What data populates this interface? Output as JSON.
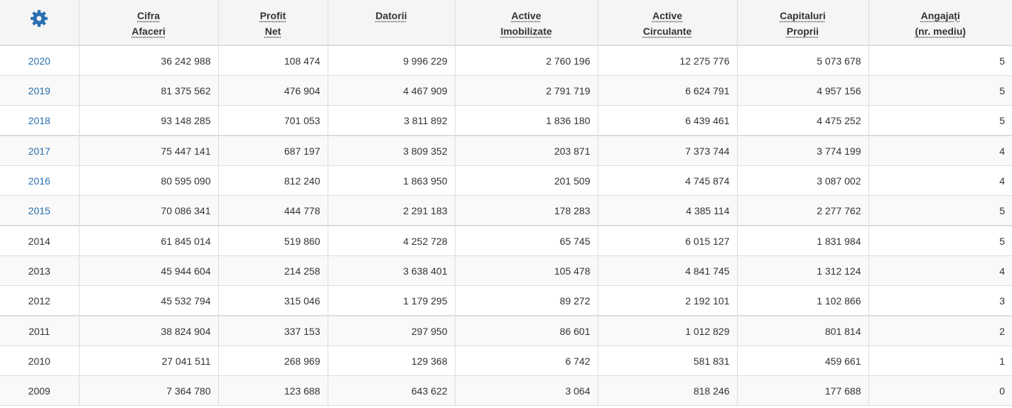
{
  "table": {
    "settings_icon": "gear-icon",
    "accent_color": "#2a6fb0",
    "columns": [
      {
        "key": "cifra_afaceri",
        "line1": "Cifra",
        "line2": "Afaceri"
      },
      {
        "key": "profit_net",
        "line1": "Profit",
        "line2": "Net"
      },
      {
        "key": "datorii",
        "line1": "Datorii",
        "line2": ""
      },
      {
        "key": "active_imobilizate",
        "line1": "Active",
        "line2": "Imobilizate"
      },
      {
        "key": "active_circulante",
        "line1": "Active",
        "line2": "Circulante"
      },
      {
        "key": "capitaluri_proprii",
        "line1": "Capitaluri",
        "line2": "Proprii"
      },
      {
        "key": "angajati",
        "line1": "Angajați",
        "line2": "(nr. mediu)"
      }
    ],
    "rows": [
      {
        "year": "2020",
        "linked": true,
        "values": [
          "36 242 988",
          "108 474",
          "9 996 229",
          "2 760 196",
          "12 275 776",
          "5 073 678",
          "5"
        ]
      },
      {
        "year": "2019",
        "linked": true,
        "values": [
          "81 375 562",
          "476 904",
          "4 467 909",
          "2 791 719",
          "6 624 791",
          "4 957 156",
          "5"
        ]
      },
      {
        "year": "2018",
        "linked": true,
        "values": [
          "93 148 285",
          "701 053",
          "3 811 892",
          "1 836 180",
          "6 439 461",
          "4 475 252",
          "5"
        ]
      },
      {
        "year": "2017",
        "linked": true,
        "values": [
          "75 447 141",
          "687 197",
          "3 809 352",
          "203 871",
          "7 373 744",
          "3 774 199",
          "4"
        ]
      },
      {
        "year": "2016",
        "linked": true,
        "values": [
          "80 595 090",
          "812 240",
          "1 863 950",
          "201 509",
          "4 745 874",
          "3 087 002",
          "4"
        ]
      },
      {
        "year": "2015",
        "linked": true,
        "values": [
          "70 086 341",
          "444 778",
          "2 291 183",
          "178 283",
          "4 385 114",
          "2 277 762",
          "5"
        ]
      },
      {
        "year": "2014",
        "linked": false,
        "values": [
          "61 845 014",
          "519 860",
          "4 252 728",
          "65 745",
          "6 015 127",
          "1 831 984",
          "5"
        ]
      },
      {
        "year": "2013",
        "linked": false,
        "values": [
          "45 944 604",
          "214 258",
          "3 638 401",
          "105 478",
          "4 841 745",
          "1 312 124",
          "4"
        ]
      },
      {
        "year": "2012",
        "linked": false,
        "values": [
          "45 532 794",
          "315 046",
          "1 179 295",
          "89 272",
          "2 192 101",
          "1 102 866",
          "3"
        ]
      },
      {
        "year": "2011",
        "linked": false,
        "values": [
          "38 824 904",
          "337 153",
          "297 950",
          "86 601",
          "1 012 829",
          "801 814",
          "2"
        ]
      },
      {
        "year": "2010",
        "linked": false,
        "values": [
          "27 041 511",
          "268 969",
          "129 368",
          "6 742",
          "581 831",
          "459 661",
          "1"
        ]
      },
      {
        "year": "2009",
        "linked": false,
        "values": [
          "7 364 780",
          "123 688",
          "643 622",
          "3 064",
          "818 246",
          "177 688",
          "0"
        ]
      }
    ]
  }
}
